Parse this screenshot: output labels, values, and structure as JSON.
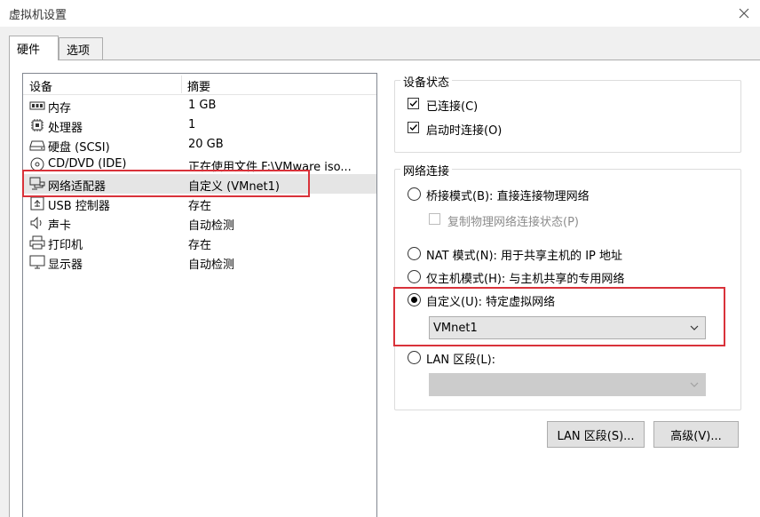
{
  "window": {
    "title": "虚拟机设置"
  },
  "tabs": [
    {
      "label": "硬件"
    },
    {
      "label": "选项"
    }
  ],
  "device_table": {
    "headers": {
      "device": "设备",
      "summary": "摘要"
    },
    "rows": [
      {
        "name": "内存",
        "summary": "1 GB",
        "icon": "memory-icon"
      },
      {
        "name": "处理器",
        "summary": "1",
        "icon": "processor-icon"
      },
      {
        "name": "硬盘 (SCSI)",
        "summary": "20 GB",
        "icon": "hard-disk-icon"
      },
      {
        "name": "CD/DVD (IDE)",
        "summary": "正在使用文件 F:\\VMware iso...",
        "icon": "cd-dvd-icon"
      },
      {
        "name": "网络适配器",
        "summary": "自定义 (VMnet1)",
        "icon": "network-adapter-icon",
        "selected": true
      },
      {
        "name": "USB 控制器",
        "summary": "存在",
        "icon": "usb-icon"
      },
      {
        "name": "声卡",
        "summary": "自动检测",
        "icon": "sound-card-icon"
      },
      {
        "name": "打印机",
        "summary": "存在",
        "icon": "printer-icon"
      },
      {
        "name": "显示器",
        "summary": "自动检测",
        "icon": "display-icon"
      }
    ]
  },
  "device_status": {
    "title": "设备状态",
    "connected": {
      "label": "已连接(C)",
      "checked": true
    },
    "connect_on_start": {
      "label": "启动时连接(O)",
      "checked": true
    }
  },
  "network": {
    "title": "网络连接",
    "bridged": {
      "label": "桥接模式(B): 直接连接物理网络",
      "checked": false
    },
    "replicate": {
      "label": "复制物理网络连接状态(P)",
      "checked": false
    },
    "nat": {
      "label": "NAT 模式(N): 用于共享主机的 IP 地址",
      "checked": false
    },
    "host_only": {
      "label": "仅主机模式(H): 与主机共享的专用网络",
      "checked": false
    },
    "custom": {
      "label": "自定义(U): 特定虚拟网络",
      "checked": true
    },
    "custom_select": {
      "value": "VMnet1"
    },
    "lan_segment": {
      "label": "LAN 区段(L):",
      "checked": false
    },
    "lan_select": {
      "value": ""
    }
  },
  "buttons": {
    "lan_segments": "LAN 区段(S)...",
    "advanced": "高级(V)..."
  },
  "colors": {
    "highlight_box": "#d9323a",
    "selected_row": "#e5e5e5"
  }
}
